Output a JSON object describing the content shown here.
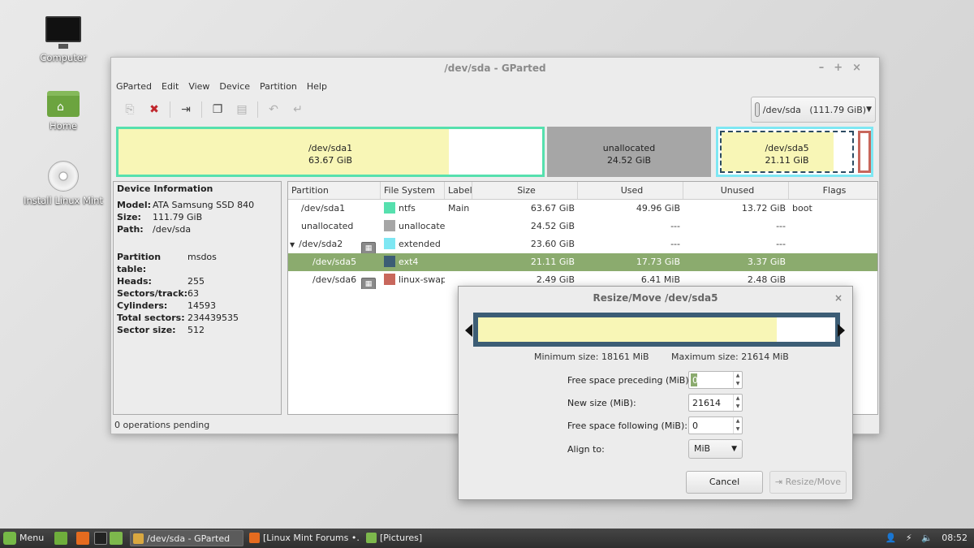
{
  "desktop": {
    "icons": [
      {
        "label": "Computer",
        "icon": "computer-icon"
      },
      {
        "label": "Home",
        "icon": "home-folder-icon"
      },
      {
        "label": "Install Linux Mint",
        "icon": "disc-icon"
      }
    ]
  },
  "window": {
    "title": "/dev/sda - GParted",
    "menu": [
      "GParted",
      "Edit",
      "View",
      "Device",
      "Partition",
      "Help"
    ],
    "device_selector": "/dev/sda   (111.79 GiB)",
    "status": "0 operations pending"
  },
  "diskmap": {
    "sda1": {
      "name": "/dev/sda1",
      "size": "63.67 GiB"
    },
    "unallocated": {
      "name": "unallocated",
      "size": "24.52 GiB"
    },
    "sda5": {
      "name": "/dev/sda5",
      "size": "21.11 GiB"
    }
  },
  "device_info": {
    "heading": "Device Information",
    "fields": [
      {
        "label": "Model:",
        "value": "ATA Samsung SSD 840"
      },
      {
        "label": "Size:",
        "value": "111.79 GiB"
      },
      {
        "label": "Path:",
        "value": "/dev/sda"
      }
    ],
    "geometry": [
      {
        "label": "Partition table:",
        "value": "msdos"
      },
      {
        "label": "Heads:",
        "value": "255"
      },
      {
        "label": "Sectors/track:",
        "value": "63"
      },
      {
        "label": "Cylinders:",
        "value": "14593"
      },
      {
        "label": "Total sectors:",
        "value": "234439535"
      },
      {
        "label": "Sector size:",
        "value": "512"
      }
    ]
  },
  "partitions": {
    "columns": [
      "Partition",
      "File System",
      "Label",
      "Size",
      "Used",
      "Unused",
      "Flags"
    ],
    "rows": [
      {
        "partition": "/dev/sda1",
        "fs": "ntfs",
        "fs_color": "#56e0ae",
        "label": "Main",
        "size": "63.67 GiB",
        "used": "49.96 GiB",
        "unused": "13.72 GiB",
        "flags": "boot"
      },
      {
        "partition": "unallocated",
        "fs": "unallocated",
        "fs_color": "#a6a6a6",
        "label": "",
        "size": "24.52 GiB",
        "used": "---",
        "unused": "---",
        "flags": ""
      },
      {
        "partition": "/dev/sda2",
        "fs": "extended",
        "fs_color": "#7ee7f3",
        "label": "",
        "size": "23.60 GiB",
        "used": "---",
        "unused": "---",
        "flags": ""
      },
      {
        "partition": "/dev/sda5",
        "fs": "ext4",
        "fs_color": "#3c5d75",
        "label": "",
        "size": "21.11 GiB",
        "used": "17.73 GiB",
        "unused": "3.37 GiB",
        "flags": ""
      },
      {
        "partition": "/dev/sda6",
        "fs": "linux-swap",
        "fs_color": "#c8675c",
        "label": "",
        "size": "2.49 GiB",
        "used": "6.41 MiB",
        "unused": "2.48 GiB",
        "flags": ""
      }
    ]
  },
  "dialog": {
    "title": "Resize/Move /dev/sda5",
    "min_size": "Minimum size: 18161 MiB",
    "max_size": "Maximum size: 21614 MiB",
    "fields": {
      "preceding_label": "Free space preceding (MiB):",
      "preceding_value": "0",
      "new_size_label": "New size (MiB):",
      "new_size_value": "21614",
      "following_label": "Free space following (MiB):",
      "following_value": "0",
      "align_label": "Align to:",
      "align_value": "MiB"
    },
    "cancel": "Cancel",
    "resize": "Resize/Move"
  },
  "taskbar": {
    "menu": "Menu",
    "tasks": [
      "/dev/sda - GParted",
      "[Linux Mint Forums •...",
      "[Pictures]"
    ],
    "clock": "08:52"
  }
}
